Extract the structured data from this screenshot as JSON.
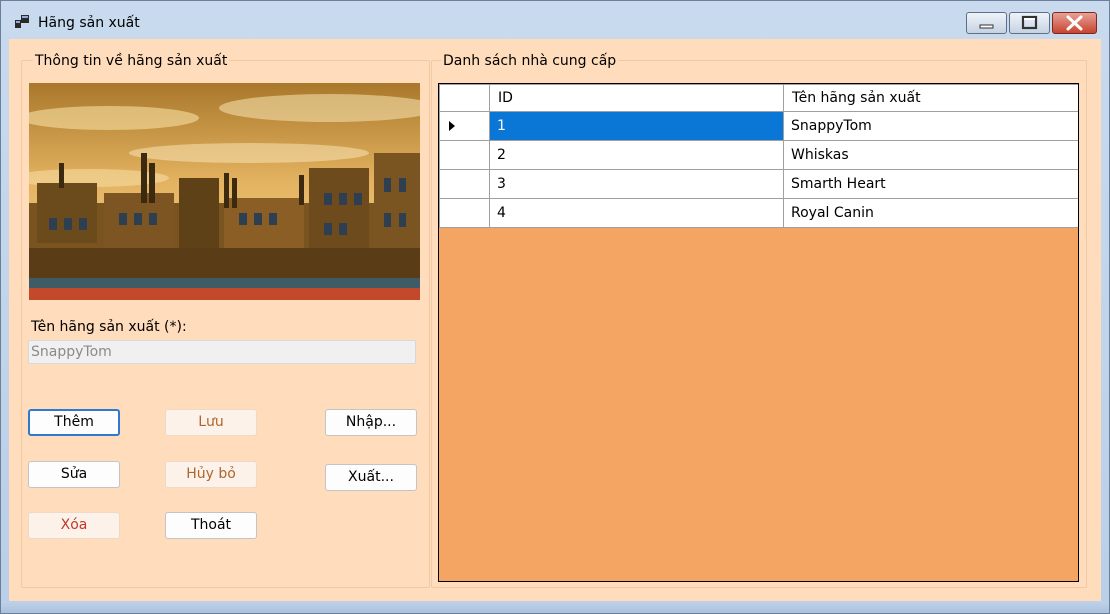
{
  "window": {
    "title": "Hãng sản xuất",
    "icon": "app-window-icon"
  },
  "left_panel": {
    "group_title": "Thông tin về hãng sản xuất",
    "picture": "factory-pixel-art-image",
    "name_label": "Tên hãng sản xuất (*):",
    "name_value": "SnappyTom",
    "buttons": {
      "add": "Thêm",
      "save": "Lưu",
      "import": "Nhập...",
      "edit": "Sửa",
      "cancel": "Hủy bỏ",
      "export": "Xuất...",
      "delete": "Xóa",
      "exit": "Thoát"
    }
  },
  "right_panel": {
    "group_title": "Danh sách nhà cung cấp",
    "columns": [
      "ID",
      "Tên hãng sản xuất"
    ],
    "rows": [
      {
        "id": "1",
        "name": "SnappyTom"
      },
      {
        "id": "2",
        "name": "Whiskas"
      },
      {
        "id": "3",
        "name": "Smarth Heart"
      },
      {
        "id": "4",
        "name": "Royal Canin"
      }
    ],
    "selected_row": 0
  },
  "colors": {
    "form_bg": "#ffdcbb",
    "grid_bg": "#f4a564",
    "selection": "#0a76d6"
  }
}
